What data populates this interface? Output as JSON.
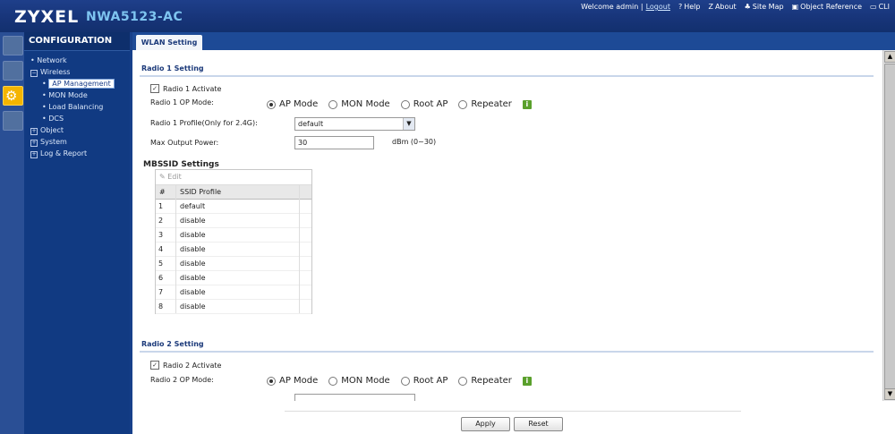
{
  "header": {
    "brand": "ZYXEL",
    "model": "NWA5123-AC",
    "welcome": "Welcome admin |",
    "logout": "Logout",
    "help": "Help",
    "about": "About",
    "site_map": "Site Map",
    "object_reference": "Object Reference",
    "cli": "CLI"
  },
  "sidebar": {
    "title": "CONFIGURATION",
    "items": [
      {
        "label": "Network"
      },
      {
        "label": "Wireless"
      },
      {
        "label": "AP Management"
      },
      {
        "label": "MON Mode"
      },
      {
        "label": "Load Balancing"
      },
      {
        "label": "DCS"
      },
      {
        "label": "Object"
      },
      {
        "label": "System"
      },
      {
        "label": "Log & Report"
      }
    ]
  },
  "tab": {
    "label": "WLAN Setting"
  },
  "radio1": {
    "section": "Radio 1 Setting",
    "activate": "Radio 1 Activate",
    "op_mode_label": "Radio 1 OP Mode:",
    "modes": [
      "AP Mode",
      "MON Mode",
      "Root AP",
      "Repeater"
    ],
    "profile_label": "Radio 1 Profile(Only for 2.4G):",
    "profile_value": "default",
    "power_label": "Max Output Power:",
    "power_value": "30",
    "power_unit": "dBm (0~30)"
  },
  "mbssid": {
    "title": "MBSSID Settings",
    "edit": "Edit",
    "col_num": "#",
    "col_ssid": "SSID Profile",
    "rows": [
      {
        "num": "1",
        "profile": "default"
      },
      {
        "num": "2",
        "profile": "disable"
      },
      {
        "num": "3",
        "profile": "disable"
      },
      {
        "num": "4",
        "profile": "disable"
      },
      {
        "num": "5",
        "profile": "disable"
      },
      {
        "num": "6",
        "profile": "disable"
      },
      {
        "num": "7",
        "profile": "disable"
      },
      {
        "num": "8",
        "profile": "disable"
      }
    ]
  },
  "radio2": {
    "section": "Radio 2 Setting",
    "activate": "Radio 2 Activate",
    "op_mode_label": "Radio 2 OP Mode:",
    "modes": [
      "AP Mode",
      "MON Mode",
      "Root AP",
      "Repeater"
    ]
  },
  "footer": {
    "apply": "Apply",
    "reset": "Reset"
  }
}
